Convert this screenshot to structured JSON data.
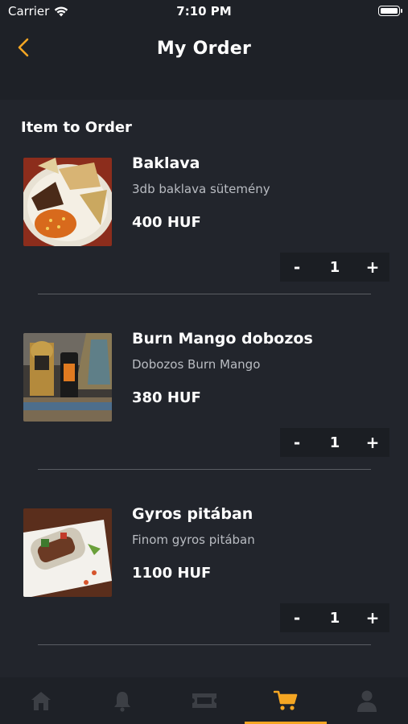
{
  "status_bar": {
    "carrier": "Carrier",
    "time": "7:10 PM"
  },
  "header": {
    "title": "My Order",
    "back_icon": "chevron-left-icon"
  },
  "section_title": "Item to Order",
  "items": [
    {
      "name": "Baklava",
      "description": "3db baklava sütemény",
      "price": "400 HUF",
      "quantity": "1",
      "minus": "-",
      "plus": "+"
    },
    {
      "name": "Burn Mango dobozos",
      "description": "Dobozos Burn Mango",
      "price": "380 HUF",
      "quantity": "1",
      "minus": "-",
      "plus": "+"
    },
    {
      "name": "Gyros pitában",
      "description": "Finom gyros pitában",
      "price": "1100 HUF",
      "quantity": "1",
      "minus": "-",
      "plus": "+"
    }
  ],
  "tab_bar": {
    "tabs": [
      {
        "icon": "home-icon"
      },
      {
        "icon": "bell-icon"
      },
      {
        "icon": "ticket-icon"
      },
      {
        "icon": "cart-icon"
      },
      {
        "icon": "user-icon"
      }
    ],
    "active_index": 3
  },
  "colors": {
    "accent": "#f5a623",
    "background": "#22252c",
    "bar": "#1e2127",
    "inactive_icon": "#3c3f45"
  }
}
